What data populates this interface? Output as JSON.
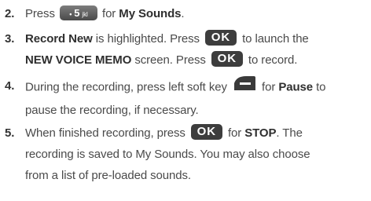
{
  "steps": [
    {
      "number": "2.",
      "pre": "Press",
      "key": "5 jkl",
      "post": "for",
      "bold": "My Sounds",
      "end": "."
    },
    {
      "number": "3.",
      "bold_start": "Record New",
      "mid1": "is highlighted. Press",
      "key1": "OK",
      "mid2": "to launch the",
      "bold_screen": "NEW VOICE MEMO",
      "mid3": "screen. Press",
      "key2": "OK",
      "end": "to record."
    },
    {
      "number": "4.",
      "pre": "During the recording, press left soft key",
      "post": "for",
      "bold": "Pause",
      "end": "to",
      "line2": "pause the recording, if necessary."
    },
    {
      "number": "5.",
      "pre": "When finished recording, press",
      "key": "OK",
      "post": "for",
      "bold": "STOP",
      "end": ". The",
      "line2": "recording is saved to My Sounds. You may also choose",
      "line3": "from a list of pre-loaded sounds."
    }
  ],
  "icons": {
    "soft_key": "left-soft-key-icon",
    "ok_key": "ok-key-icon",
    "five_key": "five-jkl-key-icon"
  }
}
